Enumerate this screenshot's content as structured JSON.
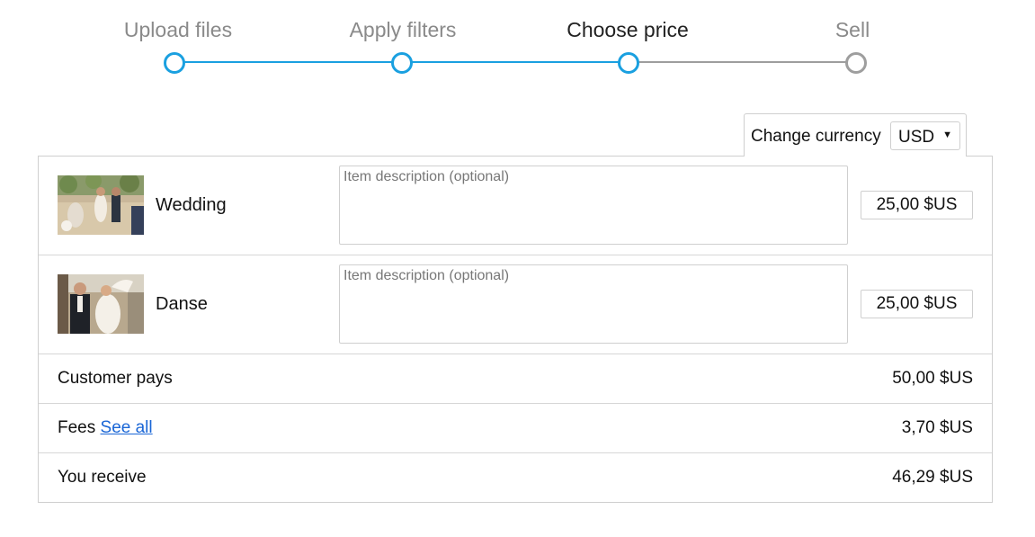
{
  "stepper": {
    "steps": [
      {
        "label": "Upload files",
        "state": "done"
      },
      {
        "label": "Apply filters",
        "state": "done"
      },
      {
        "label": "Choose price",
        "state": "current"
      },
      {
        "label": "Sell",
        "state": "todo"
      }
    ],
    "colors": {
      "done": "#1aa0e0",
      "todo": "#9e9e9e"
    }
  },
  "currency": {
    "label": "Change currency",
    "selected": "USD",
    "arrow": "▼"
  },
  "items": [
    {
      "name": "Wedding",
      "thumbnail": "wedding-photo",
      "description_placeholder": "Item description (optional)",
      "price": "25,00 $US"
    },
    {
      "name": "Danse",
      "thumbnail": "dance-photo",
      "description_placeholder": "Item description (optional)",
      "price": "25,00 $US"
    }
  ],
  "summary": {
    "customer_pays": {
      "label": "Customer pays",
      "value": "50,00 $US"
    },
    "fees": {
      "label": "Fees",
      "link": "See all",
      "value": "3,70 $US"
    },
    "you_receive": {
      "label": "You receive",
      "value": "46,29 $US"
    }
  },
  "link_color": "#1a66d6"
}
